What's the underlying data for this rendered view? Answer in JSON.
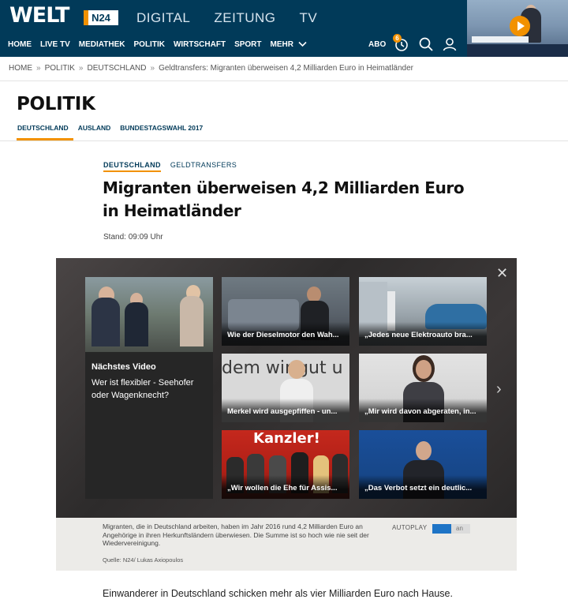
{
  "header": {
    "logo": "WELT",
    "n24": "N24",
    "brand_links": [
      "DIGITAL",
      "ZEITUNG",
      "TV"
    ],
    "nav": [
      "HOME",
      "LIVE TV",
      "MEDIATHEK",
      "POLITIK",
      "WIRTSCHAFT",
      "SPORT",
      "MEHR"
    ],
    "abo": "ABO",
    "badge_count": "6"
  },
  "breadcrumb": [
    "HOME",
    "POLITIK",
    "DEUTSCHLAND",
    "Geldtransfers: Migranten überweisen 4,2 Milliarden Euro in Heimatländer"
  ],
  "breadcrumb_sep": "»",
  "section": {
    "title": "POLITIK",
    "subnav": [
      "DEUTSCHLAND",
      "AUSLAND",
      "BUNDESTAGSWAHL 2017"
    ]
  },
  "article": {
    "tags": [
      "DEUTSCHLAND",
      "GELDTRANSFERS"
    ],
    "headline": "Migranten überweisen 4,2 Milliarden Euro in Heimatländer",
    "stand": "Stand: 09:09 Uhr",
    "body_first_line": "Einwanderer in Deutschland schicken mehr als vier Milliarden Euro nach Hause."
  },
  "player": {
    "next_label": "Nächstes Video",
    "next_title": "Wer ist flexibler - Seehofer oder Wagenknecht?",
    "tiles": [
      {
        "caption": "Wie der Dieselmotor den Wah..."
      },
      {
        "caption": "„Jedes neue Elektroauto bra..."
      },
      {
        "caption": "Merkel wird ausgepfiffen - un..."
      },
      {
        "caption": "„Mir wird davon abgeraten, in..."
      },
      {
        "caption": "„Wir wollen die Ehe für Assis..."
      },
      {
        "caption": "„Das Verbot setzt ein deutlic..."
      }
    ],
    "tile_sign_text": "dem wir gut u",
    "tile_banner_text": "Kanzler!",
    "close_glyph": "✕",
    "next_glyph": "›"
  },
  "caption": {
    "text": "Migranten, die in Deutschland arbeiten, haben im Jahr 2016 rund 4,2 Milliarden Euro an Angehörige in ihren Herkunftsländern überwiesen. Die Summe ist so hoch wie nie seit der Wiedervereinigung.",
    "autoplay": "AUTOPLAY",
    "toggle_state": "an",
    "source": "Quelle: N24/ Lukas Axiopoulos"
  },
  "colors": {
    "header_bg": "#013a59",
    "accent": "#f29100",
    "toggle_on": "#1e74c6"
  },
  "icons": [
    "clock-bookmark-icon",
    "search-icon",
    "user-icon",
    "play-icon",
    "close-icon",
    "chevron-right-icon",
    "chevron-down-icon"
  ]
}
